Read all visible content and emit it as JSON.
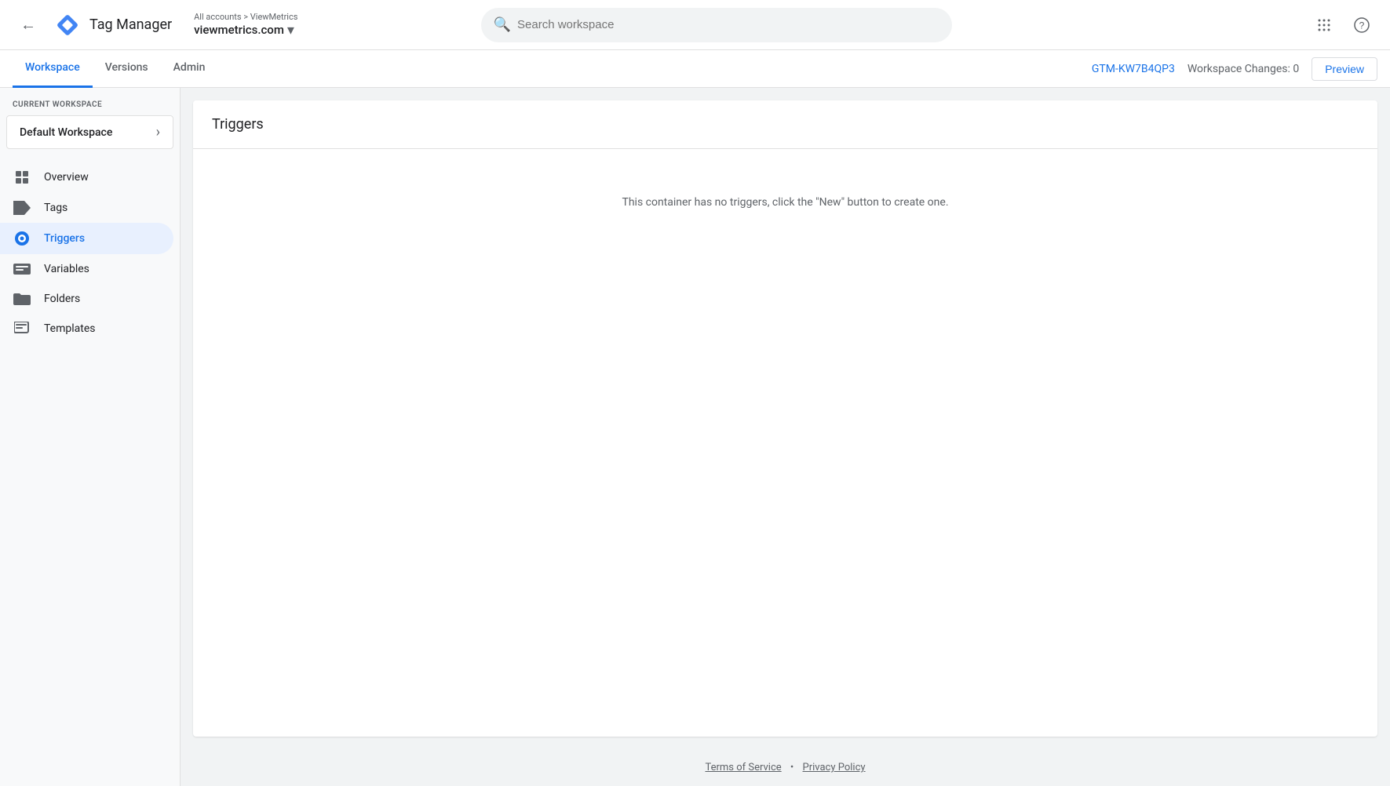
{
  "header": {
    "app_title": "Tag Manager",
    "back_label": "←",
    "account_path": "All accounts > ViewMetrics",
    "account_name": "viewmetrics.com",
    "search_placeholder": "Search workspace",
    "apps_icon": "⋮⋮",
    "help_icon": "?"
  },
  "subnav": {
    "tabs": [
      {
        "id": "workspace",
        "label": "Workspace",
        "active": true
      },
      {
        "id": "versions",
        "label": "Versions",
        "active": false
      },
      {
        "id": "admin",
        "label": "Admin",
        "active": false
      }
    ],
    "gtm_id": "GTM-KW7B4QP3",
    "workspace_changes": "Workspace Changes: 0",
    "preview_label": "Preview"
  },
  "sidebar": {
    "current_workspace_label": "CURRENT WORKSPACE",
    "workspace_name": "Default Workspace",
    "nav_items": [
      {
        "id": "overview",
        "label": "Overview",
        "active": false
      },
      {
        "id": "tags",
        "label": "Tags",
        "active": false
      },
      {
        "id": "triggers",
        "label": "Triggers",
        "active": true
      },
      {
        "id": "variables",
        "label": "Variables",
        "active": false
      },
      {
        "id": "folders",
        "label": "Folders",
        "active": false
      },
      {
        "id": "templates",
        "label": "Templates",
        "active": false
      }
    ]
  },
  "content": {
    "panel_title": "Triggers",
    "empty_message": "This container has no triggers, click the \"New\" button to create one."
  },
  "footer": {
    "terms_label": "Terms of Service",
    "separator": "•",
    "privacy_label": "Privacy Policy"
  }
}
